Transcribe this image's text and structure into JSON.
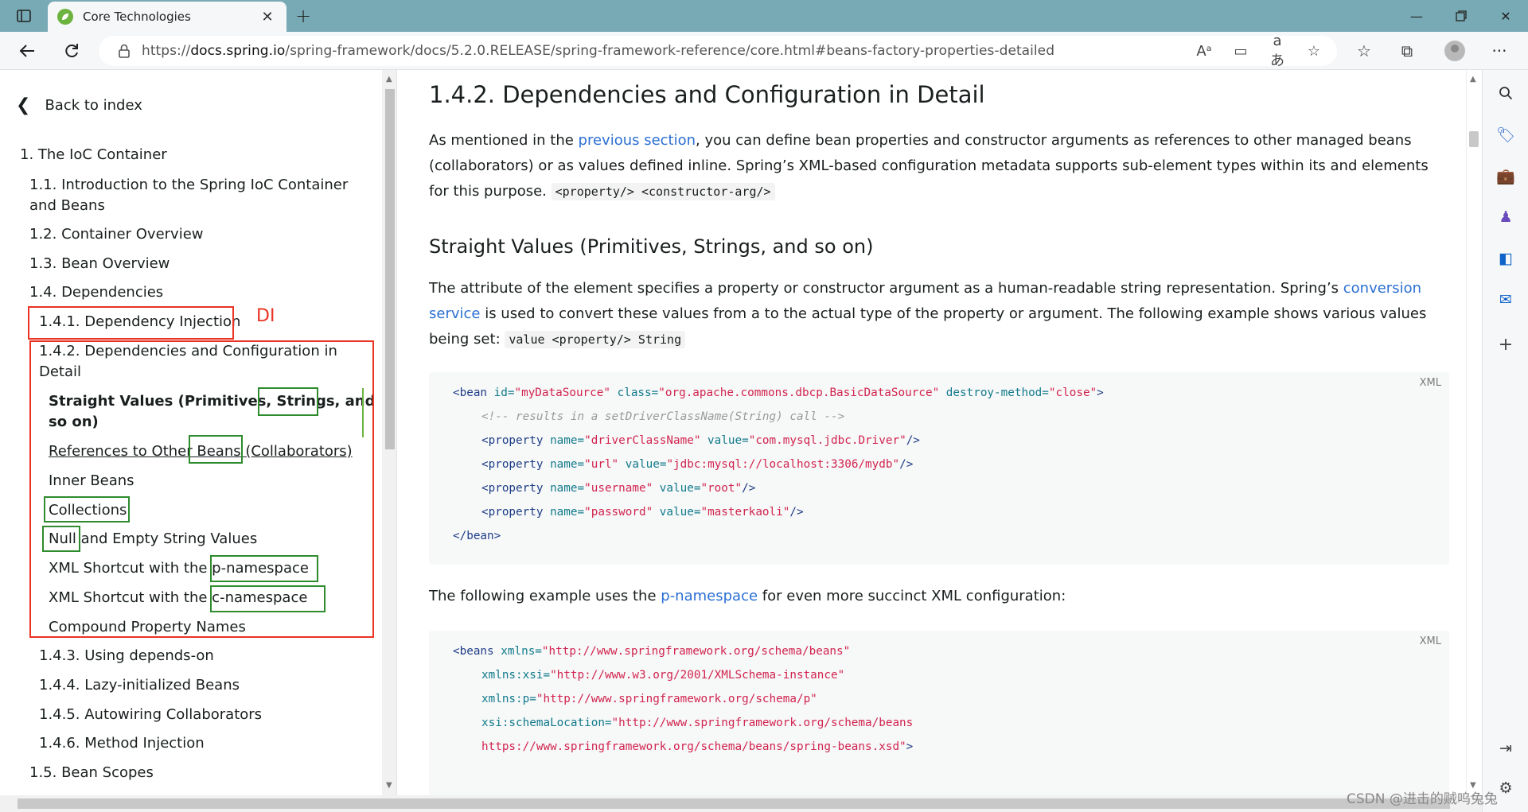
{
  "browser": {
    "tab_title": "Core Technologies",
    "url_scheme": "https://",
    "url_host": "docs.spring.io",
    "url_path": "/spring-framework/docs/5.2.0.RELEASE/spring-framework-reference/core.html#beans-factory-properties-detailed"
  },
  "toc": {
    "back": "Back to index",
    "items": [
      {
        "label": "1. The IoC Container"
      },
      {
        "label": "1.1. Introduction to the Spring IoC Container"
      },
      {
        "label": "and Beans"
      },
      {
        "label": "1.2. Container Overview"
      },
      {
        "label": "1.3. Bean Overview"
      },
      {
        "label": "1.4. Dependencies"
      },
      {
        "label": "1.4.1. Dependency Injection"
      },
      {
        "label": "1.4.2. Dependencies and Configuration in"
      },
      {
        "label": "Detail"
      },
      {
        "label": "Straight Values (Primitives, Strings, and"
      },
      {
        "label": "so on)"
      },
      {
        "label": "References to Other Beans (Collaborators)"
      },
      {
        "label": "Inner Beans"
      },
      {
        "label": "Collections"
      },
      {
        "label": "Null and Empty String Values"
      },
      {
        "label": "XML Shortcut with the p-namespace"
      },
      {
        "label": "XML Shortcut with the c-namespace"
      },
      {
        "label": "Compound Property Names"
      },
      {
        "label": "1.4.3. Using depends-on"
      },
      {
        "label": "1.4.4. Lazy-initialized Beans"
      },
      {
        "label": "1.4.5. Autowiring Collaborators"
      },
      {
        "label": "1.4.6. Method Injection"
      },
      {
        "label": "1.5. Bean Scopes"
      }
    ],
    "annotation_label": "DI"
  },
  "content": {
    "heading": "1.4.2. Dependencies and Configuration in Detail",
    "p1_a": "As mentioned in the ",
    "p1_link": "previous section",
    "p1_b": ", you can define bean properties and constructor arguments as references to other managed beans",
    "p1_c": "(collaborators) or as values defined inline. Spring’s XML-based configuration metadata supports sub-element types within its and elements",
    "p1_d": "for this purpose.",
    "p1_code": "<property/> <constructor-arg/>",
    "h3": "Straight Values (Primitives, Strings, and so on)",
    "p2_a": "The attribute of the element specifies a property or constructor argument as a human-readable string representation. Spring’s ",
    "p2_link1": "conversion",
    "p2_link2": "service",
    "p2_b": " is used to convert these values from a to the actual type of the property or argument. The following example shows various values",
    "p2_c": "being set:",
    "p2_code": "value <property/> String",
    "p3_a": "The following example uses the ",
    "p3_link": "p-namespace",
    "p3_b": " for even more succinct XML configuration:",
    "code_lang": "XML",
    "code1": {
      "l1_tag": "<bean ",
      "l1_a1": "id=",
      "l1_v1": "\"myDataSource\"",
      "l1_a2": " class=",
      "l1_v2": "\"org.apache.commons.dbcp.BasicDataSource\"",
      "l1_a3": " destroy-method=",
      "l1_v3": "\"close\"",
      "l1_end": ">",
      "l2_comment": "<!-- results in a setDriverClassName(String) call -->",
      "props": [
        {
          "name": "\"driverClassName\"",
          "value": "\"com.mysql.jdbc.Driver\""
        },
        {
          "name": "\"url\"",
          "value": "\"jdbc:mysql://localhost:3306/mydb\""
        },
        {
          "name": "\"username\"",
          "value": "\"root\""
        },
        {
          "name": "\"password\"",
          "value": "\"masterkaoli\""
        }
      ],
      "prop_tag": "<property ",
      "prop_name_attr": "name=",
      "prop_value_attr": " value=",
      "prop_end": "/>",
      "close": "</bean>"
    },
    "code2": {
      "l1_tag": "<beans ",
      "l1_a": "xmlns=",
      "l1_v": "\"http://www.springframework.org/schema/beans\"",
      "l2_a": "xmlns:xsi=",
      "l2_v": "\"http://www.w3.org/2001/XMLSchema-instance\"",
      "l3_a": "xmlns:p=",
      "l3_v": "\"http://www.springframework.org/schema/p\"",
      "l4_a": "xsi:schemaLocation=",
      "l4_v": "\"http://www.springframework.org/schema/beans",
      "l5_v": "https://www.springframework.org/schema/beans/spring-beans.xsd\"",
      "l5_end": ">"
    }
  },
  "watermark": "CSDN @进击的贼呜兔兔"
}
